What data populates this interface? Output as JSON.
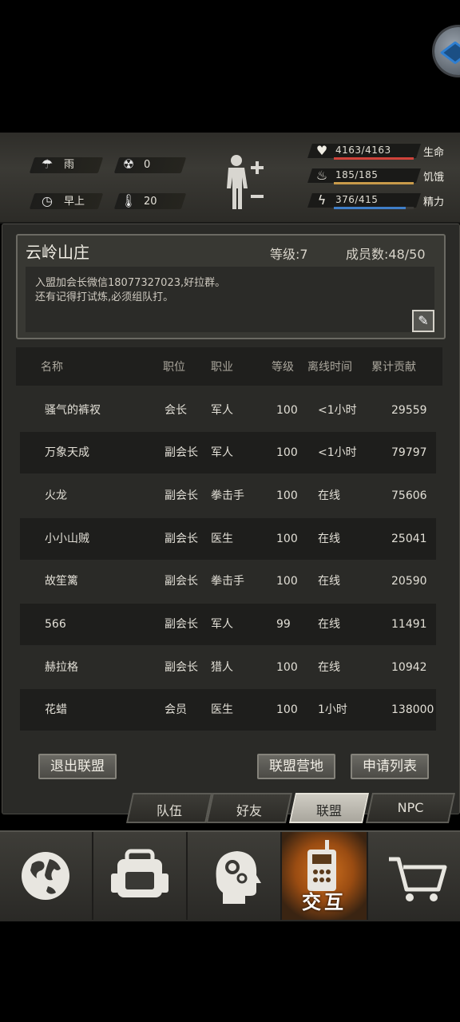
{
  "status": {
    "weather": "雨",
    "radiation": "0",
    "time_of_day": "早上",
    "temperature": "20",
    "bars": [
      {
        "value": "4163/4163",
        "label": "生命",
        "color": "#d0433b",
        "fraction": 1.0
      },
      {
        "value": "185/185",
        "label": "饥饿",
        "color": "#c89a4a",
        "fraction": 1.0
      },
      {
        "value": "376/415",
        "label": "精力",
        "color": "#3f7ec8",
        "fraction": 0.906
      }
    ],
    "icons": {
      "weather": "rain-cloud-icon",
      "radiation": "radiation-icon",
      "time": "clock-icon",
      "temperature": "thermometer-icon",
      "body": "body-status-icon"
    }
  },
  "guild": {
    "name": "云岭山庄",
    "level": "等级:7",
    "members": "成员数:48/50",
    "notice_line1": "入盟加会长微信18077327023,好拉群。",
    "notice_line2": "还有记得打试炼,必须组队打。"
  },
  "table": {
    "headers": [
      "名称",
      "职位",
      "职业",
      "等级",
      "离线时间",
      "累计贡献"
    ],
    "rows": [
      [
        "骚气的裤衩",
        "会长",
        "军人",
        "100",
        "<1小时",
        "29559"
      ],
      [
        "万象天成",
        "副会长",
        "军人",
        "100",
        "<1小时",
        "79797"
      ],
      [
        "火龙",
        "副会长",
        "拳击手",
        "100",
        "在线",
        "75606"
      ],
      [
        "小小山贼",
        "副会长",
        "医生",
        "100",
        "在线",
        "25041"
      ],
      [
        "故笙篱",
        "副会长",
        "拳击手",
        "100",
        "在线",
        "20590"
      ],
      [
        "566",
        "副会长",
        "军人",
        "99",
        "在线",
        "11491"
      ],
      [
        "赫拉格",
        "副会长",
        "猎人",
        "100",
        "在线",
        "10942"
      ],
      [
        "花蜡",
        "会员",
        "医生",
        "100",
        "1小时",
        "138000"
      ]
    ]
  },
  "buttons": {
    "quit": "退出联盟",
    "camp": "联盟营地",
    "apply_list": "申请列表"
  },
  "subtabs": [
    "队伍",
    "好友",
    "联盟",
    "NPC"
  ],
  "nav": {
    "interact_label": "交互",
    "items": [
      "world-map-icon",
      "backpack-icon",
      "skills-head-icon",
      "interact-radio-icon",
      "shop-cart-icon"
    ]
  }
}
